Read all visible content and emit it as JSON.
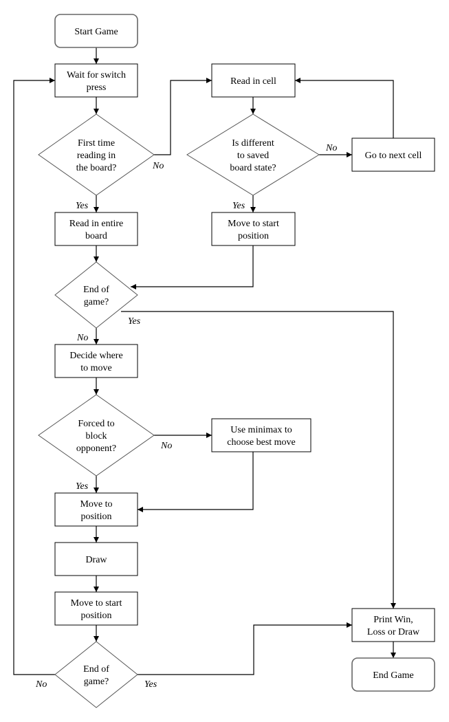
{
  "diagram": {
    "type": "flowchart",
    "colors": {
      "stroke": "#000000",
      "terminal_stroke": "#666666",
      "background": "#ffffff"
    },
    "nodes": [
      {
        "id": "start",
        "kind": "terminal",
        "lines": [
          "Start Game"
        ]
      },
      {
        "id": "wait",
        "kind": "process",
        "lines": [
          "Wait for switch",
          "press"
        ]
      },
      {
        "id": "first_time",
        "kind": "decision",
        "lines": [
          "First time",
          "reading in",
          "the board?"
        ]
      },
      {
        "id": "read_entire",
        "kind": "process",
        "lines": [
          "Read in entire",
          "board"
        ]
      },
      {
        "id": "end_of_game_1",
        "kind": "decision",
        "lines": [
          "End of",
          "game?"
        ]
      },
      {
        "id": "decide",
        "kind": "process",
        "lines": [
          "Decide where",
          "to move"
        ]
      },
      {
        "id": "forced_block",
        "kind": "decision",
        "lines": [
          "Forced to",
          "block",
          "opponent?"
        ]
      },
      {
        "id": "move_pos",
        "kind": "process",
        "lines": [
          "Move to",
          "position"
        ]
      },
      {
        "id": "draw",
        "kind": "process",
        "lines": [
          "Draw"
        ]
      },
      {
        "id": "move_start_2",
        "kind": "process",
        "lines": [
          "Move to start",
          "position"
        ]
      },
      {
        "id": "end_of_game_2",
        "kind": "decision",
        "lines": [
          "End of",
          "game?"
        ]
      },
      {
        "id": "read_cell",
        "kind": "process",
        "lines": [
          "Read in cell"
        ]
      },
      {
        "id": "is_different",
        "kind": "decision",
        "lines": [
          "Is different",
          "to saved",
          "board state?"
        ]
      },
      {
        "id": "next_cell",
        "kind": "process",
        "lines": [
          "Go to next cell"
        ]
      },
      {
        "id": "move_start_1",
        "kind": "process",
        "lines": [
          "Move to start",
          "position"
        ]
      },
      {
        "id": "minimax",
        "kind": "process",
        "lines": [
          "Use minimax to",
          "choose best move"
        ]
      },
      {
        "id": "print_result",
        "kind": "process",
        "lines": [
          "Print Win,",
          "Loss or Draw"
        ]
      },
      {
        "id": "end",
        "kind": "terminal",
        "lines": [
          "End Game"
        ]
      }
    ],
    "edges": [
      {
        "from": "start",
        "to": "wait",
        "label": ""
      },
      {
        "from": "wait",
        "to": "first_time",
        "label": ""
      },
      {
        "from": "first_time",
        "to": "read_entire",
        "label": "Yes"
      },
      {
        "from": "first_time",
        "to": "read_cell",
        "label": "No"
      },
      {
        "from": "read_cell",
        "to": "is_different",
        "label": ""
      },
      {
        "from": "is_different",
        "to": "next_cell",
        "label": "No"
      },
      {
        "from": "next_cell",
        "to": "read_cell",
        "label": ""
      },
      {
        "from": "is_different",
        "to": "move_start_1",
        "label": "Yes"
      },
      {
        "from": "move_start_1",
        "to": "end_of_game_1",
        "label": ""
      },
      {
        "from": "read_entire",
        "to": "end_of_game_1",
        "label": ""
      },
      {
        "from": "end_of_game_1",
        "to": "decide",
        "label": "No"
      },
      {
        "from": "end_of_game_1",
        "to": "print_result",
        "label": "Yes"
      },
      {
        "from": "decide",
        "to": "forced_block",
        "label": ""
      },
      {
        "from": "forced_block",
        "to": "move_pos",
        "label": "Yes"
      },
      {
        "from": "forced_block",
        "to": "minimax",
        "label": "No"
      },
      {
        "from": "minimax",
        "to": "move_pos",
        "label": ""
      },
      {
        "from": "move_pos",
        "to": "draw",
        "label": ""
      },
      {
        "from": "draw",
        "to": "move_start_2",
        "label": ""
      },
      {
        "from": "move_start_2",
        "to": "end_of_game_2",
        "label": ""
      },
      {
        "from": "end_of_game_2",
        "to": "wait",
        "label": "No"
      },
      {
        "from": "end_of_game_2",
        "to": "print_result",
        "label": "Yes"
      },
      {
        "from": "print_result",
        "to": "end",
        "label": ""
      }
    ]
  }
}
